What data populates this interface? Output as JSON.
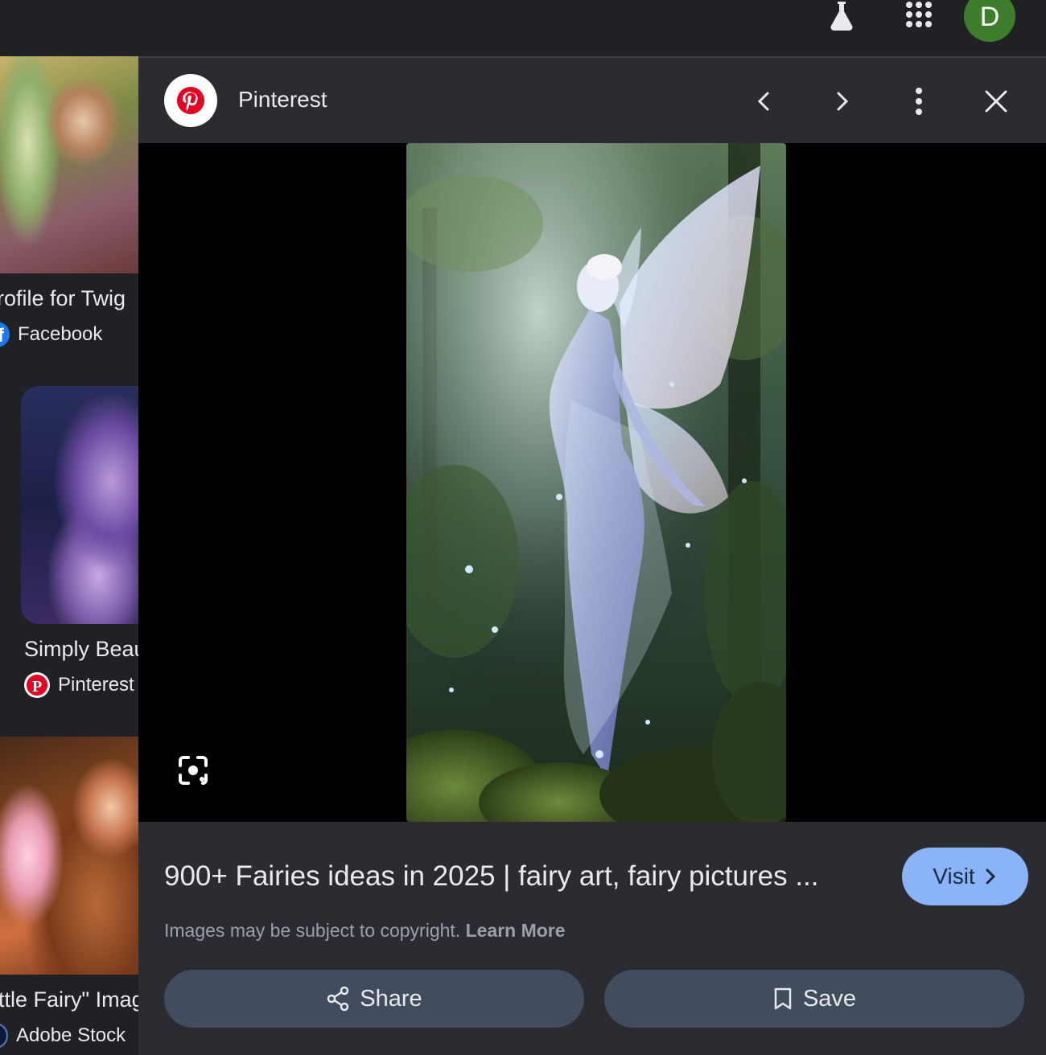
{
  "topbar": {
    "labs_icon": "flask-icon",
    "apps_icon": "apps-grid-icon",
    "avatar_letter": "D",
    "avatar_color": "#3d7d2b"
  },
  "results": [
    {
      "title": "rofile for Twig",
      "source": "Facebook",
      "source_icon": "facebook-icon"
    },
    {
      "title": "Simply Beau",
      "source": "Pinterest",
      "source_icon": "pinterest-icon"
    },
    {
      "title": "ttle Fairy\" Imag",
      "source": "Adobe Stock",
      "source_icon": "adobe-stock-icon"
    }
  ],
  "preview": {
    "site_name": "Pinterest",
    "site_icon": "pinterest-icon",
    "title": "900+ Fairies ideas in 2025 | fairy art, fairy pictures ...",
    "visit_label": "Visit",
    "copyright_text": "Images may be subject to copyright.",
    "learn_more_label": "Learn More",
    "share_label": "Share",
    "save_label": "Save"
  },
  "colors": {
    "accent": "#8ab4f8",
    "pinterest_red": "#e60023",
    "panel_bg": "#2a2c31",
    "button_bg": "#414c5f"
  }
}
